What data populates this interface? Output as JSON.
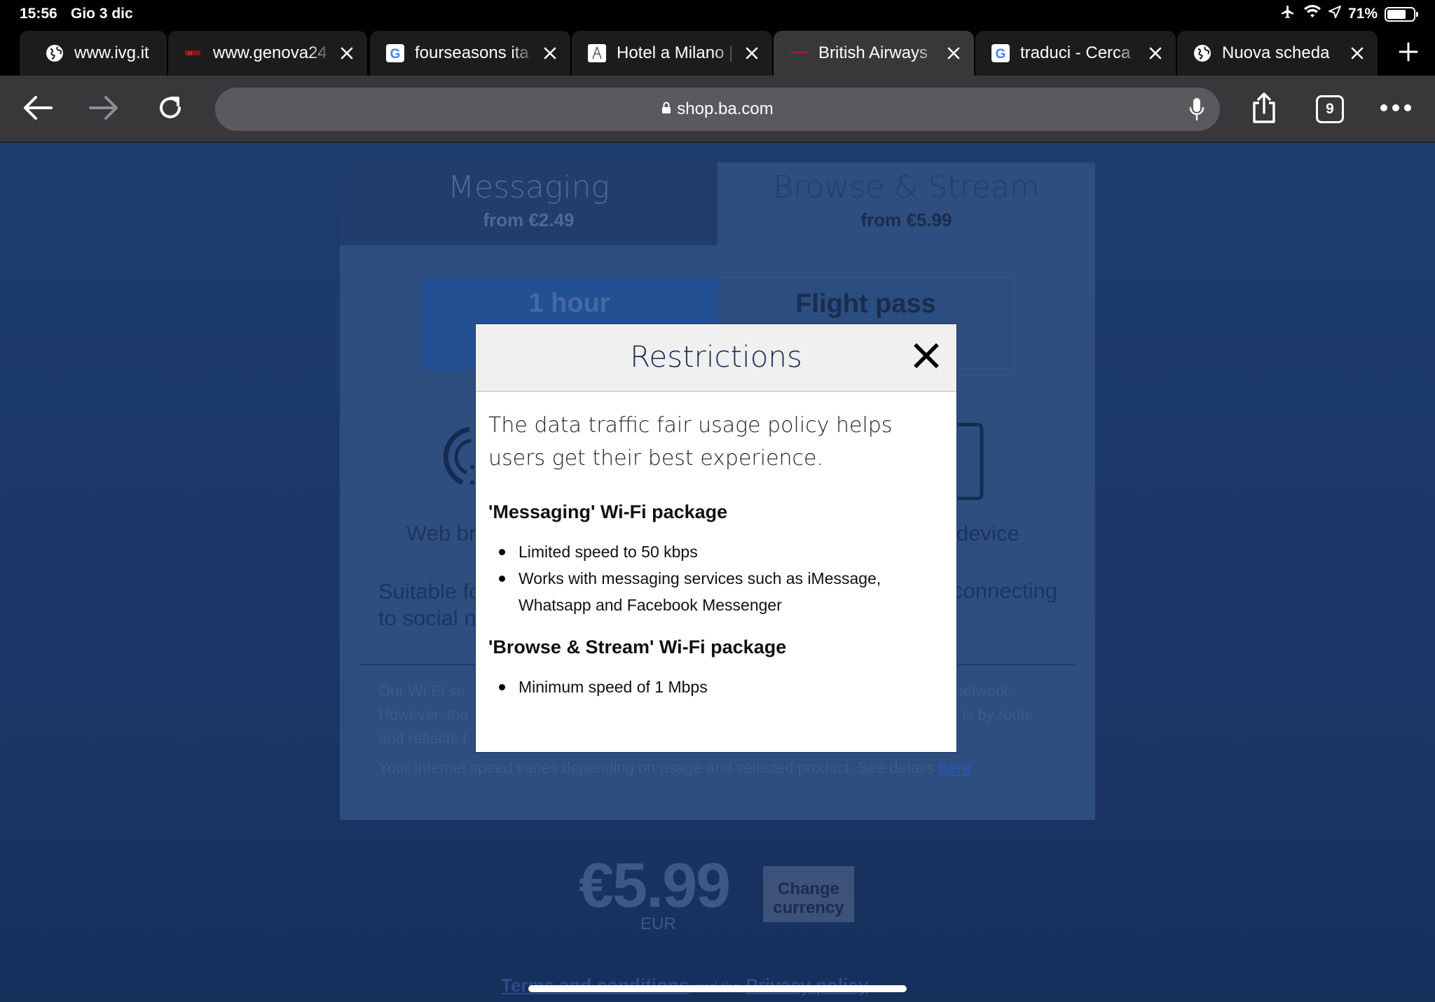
{
  "status": {
    "time": "15:56",
    "date": "Gio 3 dic",
    "battery": "71%"
  },
  "tabs": [
    {
      "title": "www.ivg.it",
      "icon": "globe-icon"
    },
    {
      "title": "www.genova24",
      "icon": "site-favicon"
    },
    {
      "title": "fourseasons ita",
      "icon": "google-icon"
    },
    {
      "title": "Hotel a Milano |",
      "icon": "hotel-favicon"
    },
    {
      "title": "British Airways",
      "icon": "ba-favicon",
      "active": true
    },
    {
      "title": "traduci - Cerca",
      "icon": "google-icon"
    },
    {
      "title": "Nuova scheda",
      "icon": "globe-icon"
    }
  ],
  "toolbar": {
    "url": "shop.ba.com",
    "tab_count": "9"
  },
  "page": {
    "tab_messaging": {
      "name": "Messaging",
      "price": "from €2.49"
    },
    "tab_browse": {
      "name": "Browse & Stream",
      "price": "from €5.99"
    },
    "duration_1h": "1 hour",
    "duration_flight": "Flight pass",
    "feature_left": "Web br",
    "feature_right": "device",
    "suitable_left_1": "Suitable fo",
    "suitable_left_2": "to social n",
    "suitable_right": "connecting",
    "info_1a": "Our Wi-Fi se",
    "info_1b": "network.",
    "info_2a": "However, the",
    "info_2b": "g is by route",
    "info_3a": "and reflects t",
    "speed_note": "Your Internet speed varies depending on usage and selected product. See details",
    "speed_link": "here",
    "price": "€5.99",
    "currency": "EUR",
    "change_currency": "Change currency",
    "footer_terms": "Terms and conditions",
    "footer_and": "and the",
    "footer_privacy": "Privacy policy"
  },
  "modal": {
    "title": "Restrictions",
    "intro": "The data traffic fair usage policy helps users get their best experience.",
    "section1": "'Messaging' Wi-Fi package",
    "section1_items": [
      "Limited speed to 50 kbps",
      "Works with messaging services such as iMessage, Whatsapp and Facebook Messenger"
    ],
    "section2": "'Browse & Stream' Wi-Fi package",
    "section2_items": [
      "Minimum speed of 1 Mbps"
    ]
  }
}
